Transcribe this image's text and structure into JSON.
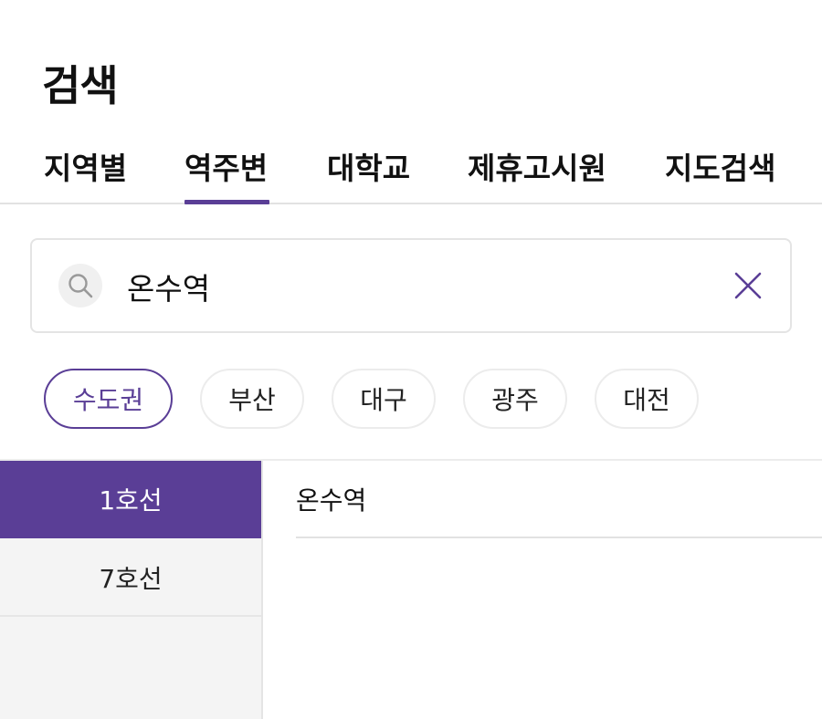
{
  "header": {
    "title": "검색"
  },
  "tabs": [
    {
      "label": "지역별"
    },
    {
      "label": "역주변"
    },
    {
      "label": "대학교"
    },
    {
      "label": "제휴고시원"
    },
    {
      "label": "지도검색"
    }
  ],
  "active_tab": "역주변",
  "search": {
    "value": "온수역",
    "search_icon": "search-icon",
    "clear_icon": "close-icon"
  },
  "regions": [
    {
      "label": "수도권"
    },
    {
      "label": "부산"
    },
    {
      "label": "대구"
    },
    {
      "label": "광주"
    },
    {
      "label": "대전"
    }
  ],
  "active_region": "수도권",
  "lines": [
    {
      "label": "1호선"
    },
    {
      "label": "7호선"
    }
  ],
  "active_line": "1호선",
  "stations": [
    {
      "label": "온수역"
    }
  ],
  "colors": {
    "accent": "#5a3e96",
    "panel_bg": "#f4f4f4",
    "border": "#e4e4e4"
  }
}
